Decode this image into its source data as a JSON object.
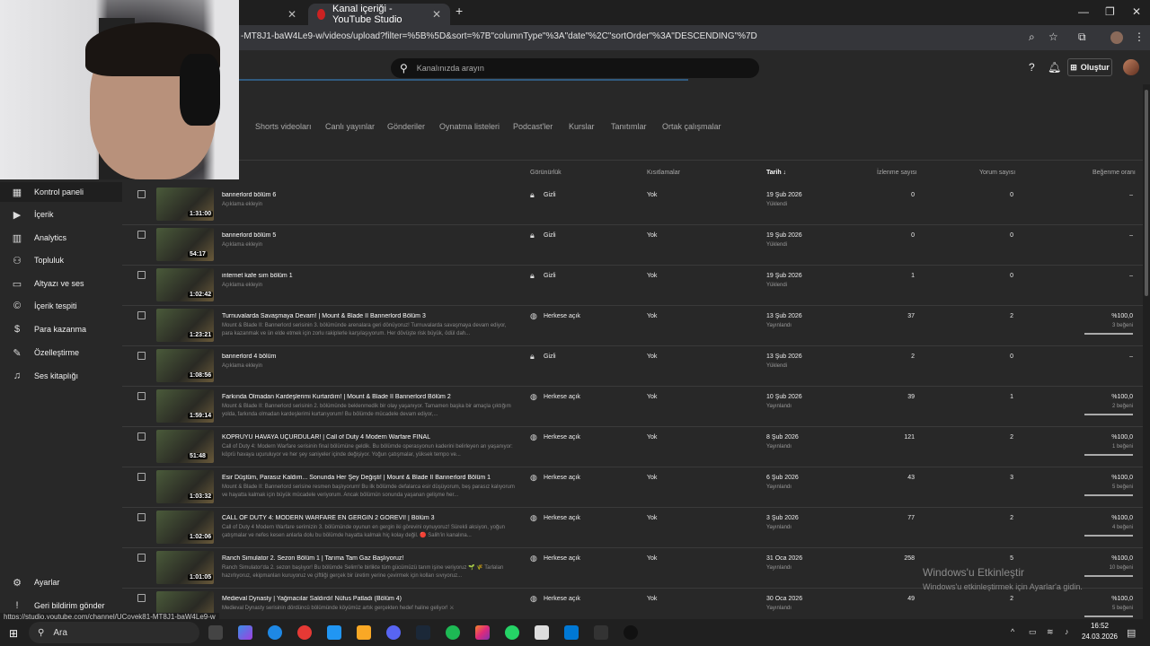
{
  "browser": {
    "tabs": [
      {
        "label": "e"
      },
      {
        "label": "Kanal içeriği - YouTube Studio"
      }
    ],
    "new_tab": "+",
    "url": "-MT8J1-baW4Le9-w/videos/upload?filter=%5B%5D&sort=%7B\"columnType\"%3A\"date\"%2C\"sortOrder\"%3A\"DESCENDING\"%7D",
    "status_url": "https://studio.youtube.com/channel/UCoyek81-MT8J1-baW4Le9-w"
  },
  "header": {
    "search_placeholder": "Kanalınızda arayın",
    "create_label": "Oluştur"
  },
  "sidebar": {
    "items": [
      {
        "label": "Kontrol paneli",
        "icon": "dashboard-icon"
      },
      {
        "label": "İçerik",
        "icon": "content-icon"
      },
      {
        "label": "Analytics",
        "icon": "analytics-icon"
      },
      {
        "label": "Topluluk",
        "icon": "community-icon"
      },
      {
        "label": "Altyazı ve ses",
        "icon": "subtitles-icon"
      },
      {
        "label": "İçerik tespiti",
        "icon": "copyright-icon"
      },
      {
        "label": "Para kazanma",
        "icon": "monetization-icon"
      },
      {
        "label": "Özelleştirme",
        "icon": "customization-icon"
      },
      {
        "label": "Ses kitaplığı",
        "icon": "audio-library-icon"
      }
    ],
    "settings": "Ayarlar",
    "feedback": "Geri bildirim gönder"
  },
  "content_tabs": [
    "Shorts videoları",
    "Canlı yayınlar",
    "Gönderiler",
    "Oynatma listeleri",
    "Podcast'ler",
    "Kurslar",
    "Tanıtımlar",
    "Ortak çalışmalar"
  ],
  "columns": {
    "visibility": "Görünürlük",
    "restrictions": "Kısıtlamalar",
    "date": "Tarih ↓",
    "views": "İzlenme sayısı",
    "comments": "Yorum sayısı",
    "likes": "Beğenme oranı"
  },
  "videos": [
    {
      "title": "bannerlord bölüm 6",
      "desc": "Açıklama ekleyin",
      "duration": "1:31:00",
      "visibility": "Gizli",
      "restrictions": "Yok",
      "date": "19 Şub 2026",
      "status": "Yüklendi",
      "views": "0",
      "comments": "0",
      "likes": "–",
      "likes_sub": "",
      "like_ratio": null
    },
    {
      "title": "bannerlord bölüm 5",
      "desc": "Açıklama ekleyin",
      "duration": "54:17",
      "visibility": "Gizli",
      "restrictions": "Yok",
      "date": "19 Şub 2026",
      "status": "Yüklendi",
      "views": "0",
      "comments": "0",
      "likes": "–",
      "likes_sub": "",
      "like_ratio": null
    },
    {
      "title": "internet kafe sım bölüm 1",
      "desc": "Açıklama ekleyin",
      "duration": "1:02:42",
      "visibility": "Gizli",
      "restrictions": "Yok",
      "date": "19 Şub 2026",
      "status": "Yüklendi",
      "views": "1",
      "comments": "0",
      "likes": "–",
      "likes_sub": "",
      "like_ratio": null
    },
    {
      "title": "Turnuvalarda Savaşmaya Devam! | Mount & Blade II Bannerlord Bölüm 3",
      "desc": "Mount & Blade II: Bannerlord serisinin 3. bölümünde arenalara geri dönüyoruz! Turnuvalarda savaşmaya devam ediyor, para kazanmak ve ün elde etmek için zorlu rakiplerle karşılaşıyorum. Her dövüşte risk büyük, ödül dah...",
      "duration": "1:23:21",
      "visibility": "Herkese açık",
      "restrictions": "Yok",
      "date": "13 Şub 2026",
      "status": "Yayınlandı",
      "views": "37",
      "comments": "2",
      "likes": "%100,0",
      "likes_sub": "3 beğeni",
      "like_ratio": 1.0
    },
    {
      "title": "bannerlord 4 bölüm",
      "desc": "Açıklama ekleyin",
      "duration": "1:08:56",
      "visibility": "Gizli",
      "restrictions": "Yok",
      "date": "13 Şub 2026",
      "status": "Yüklendi",
      "views": "2",
      "comments": "0",
      "likes": "–",
      "likes_sub": "",
      "like_ratio": null
    },
    {
      "title": "Farkında Olmadan Kardeşlerimi Kurtardım! | Mount & Blade II Bannerlord Bölüm 2",
      "desc": "Mount & Blade II: Bannerlord serisinin 2. bölümünde beklenmedik bir olay yaşanıyor. Tamamen başka bir amaçla çıktığım yolda, farkında olmadan kardeşlerimi kurtarıyorum! Bu bölümde mücadele devam ediyor,...",
      "duration": "1:59:14",
      "visibility": "Herkese açık",
      "restrictions": "Yok",
      "date": "10 Şub 2026",
      "status": "Yayınlandı",
      "views": "39",
      "comments": "1",
      "likes": "%100,0",
      "likes_sub": "2 beğeni",
      "like_ratio": 1.0
    },
    {
      "title": "KÖPRÜYÜ HAVAYA UÇURDULAR! | Call of Duty 4 Modern Warfare FINAL",
      "desc": "Call of Duty 4: Modern Warfare serisinin final bölümüne geldik. Bu bölümde operasyonun kaderini belirleyen an yaşanıyor: köprü havaya uçuruluyor ve her şey saniyeler içinde değişiyor. Yoğun çatışmalar, yüksek tempo ve...",
      "duration": "51:48",
      "visibility": "Herkese açık",
      "restrictions": "Yok",
      "date": "8 Şub 2026",
      "status": "Yayınlandı",
      "views": "121",
      "comments": "2",
      "likes": "%100,0",
      "likes_sub": "1 beğeni",
      "like_ratio": 1.0
    },
    {
      "title": "Esir Düştüm, Parasız Kaldım... Sonunda Her Şey Değişti! | Mount & Blade II Bannerlord Bölüm 1",
      "desc": "Mount & Blade II: Bannerlord serisine resmen başlıyorum! Bu ilk bölümde defalarca esir düşüyorum, beş parasız kalıyorum ve hayatta kalmak için büyük mücadele veriyorum. Ancak bölümün sonunda yaşanan gelişme her...",
      "duration": "1:03:32",
      "visibility": "Herkese açık",
      "restrictions": "Yok",
      "date": "6 Şub 2026",
      "status": "Yayınlandı",
      "views": "43",
      "comments": "3",
      "likes": "%100,0",
      "likes_sub": "5 beğeni",
      "like_ratio": 1.0
    },
    {
      "title": "CALL OF DUTY 4: MODERN WARFARE EN GERGİN 2 GÖREVİ! | Bölüm 3",
      "desc": "Call of Duty 4 Modern Warfare serimizin 3. bölümünde oyunun en gergin iki görevini oynuyoruz! Sürekli aksiyon, yoğun çatışmalar ve nefes kesen anlarla dolu bu bölümde hayatta kalmak hiç kolay değil. 🔴 Salih'in kanalına...",
      "duration": "1:02:06",
      "visibility": "Herkese açık",
      "restrictions": "Yok",
      "date": "3 Şub 2026",
      "status": "Yayınlandı",
      "views": "77",
      "comments": "2",
      "likes": "%100,0",
      "likes_sub": "4 beğeni",
      "like_ratio": 1.0
    },
    {
      "title": "Ranch Simulator 2. Sezon Bölüm 1 | Tarıma Tam Gaz Başlıyoruz!",
      "desc": "Ranch Simulator'da 2. sezon başlıyor! Bu bölümde Selim'le birlikte tüm gücümüzü tarım işine veriyoruz 🌱 🌾 Tarlaları hazırlıyoruz, ekipmanları kuruyoruz ve çiftliği gerçek bir üretim yerine çevirmek için kolları sıvıyoruz...",
      "duration": "1:01:05",
      "visibility": "Herkese açık",
      "restrictions": "Yok",
      "date": "31 Oca 2026",
      "status": "Yayınlandı",
      "views": "258",
      "comments": "5",
      "likes": "%100,0",
      "likes_sub": "10 beğeni",
      "like_ratio": 1.0
    },
    {
      "title": "Medieval Dynasty | Yağmacılar Saldırdı! Nüfus Patladı (Bölüm 4)",
      "desc": "Medieval Dynasty serisinin dördüncü bölümünde köyümüz artık gerçekten hedef haline geliyor! ⚔",
      "duration": "",
      "visibility": "Herkese açık",
      "restrictions": "Yok",
      "date": "30 Oca 2026",
      "status": "Yayınlandı",
      "views": "49",
      "comments": "2",
      "likes": "%100,0",
      "likes_sub": "5 beğeni",
      "like_ratio": 1.0
    }
  ],
  "watermark": {
    "line1": "Windows'u Etkinleştir",
    "line2": "Windows'u etkinleştirmek için Ayarlar'a gidin."
  },
  "taskbar": {
    "search_label": "Ara",
    "time": "16:52",
    "date": "24.03.2026"
  }
}
